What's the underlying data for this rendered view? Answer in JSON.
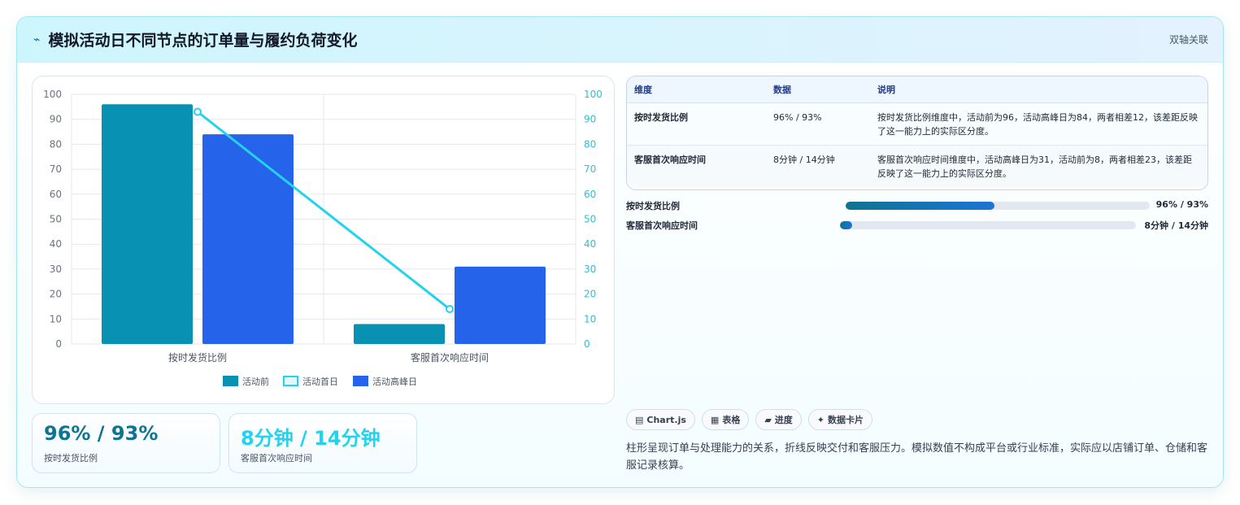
{
  "header": {
    "icon": "pulse-icon",
    "title": "模拟活动日不同节点的订单量与履约负荷变化",
    "tag": "双轴关联"
  },
  "chart_data": {
    "type": "bar",
    "categories": [
      "按时发货比例",
      "客服首次响应时间"
    ],
    "series": [
      {
        "name": "活动前",
        "type": "bar",
        "axis": "left",
        "color": "#0891b2",
        "values": [
          96,
          8
        ]
      },
      {
        "name": "活动首日",
        "type": "line",
        "axis": "right",
        "color": "#22d3ee",
        "values": [
          93,
          14
        ]
      },
      {
        "name": "活动高峰日",
        "type": "bar",
        "axis": "left",
        "color": "#2563eb",
        "values": [
          84,
          31
        ]
      }
    ],
    "ylim": [
      0,
      100
    ],
    "y2lim": [
      0,
      100
    ],
    "yticks": [
      0,
      10,
      20,
      30,
      40,
      50,
      60,
      70,
      80,
      90,
      100
    ],
    "grid": true,
    "legend": "bottom",
    "title": "",
    "xlabel": "",
    "ylabel": ""
  },
  "stats": [
    {
      "value": "96% / 93%",
      "label": "按时发货比例",
      "color": "#0e7490"
    },
    {
      "value": "8分钟 / 14分钟",
      "label": "客服首次响应时间",
      "color": "#22d3ee"
    }
  ],
  "table": {
    "headers": [
      "维度",
      "数据",
      "说明"
    ],
    "rows": [
      [
        "按时发货比例",
        "96% / 93%",
        "按时发货比例维度中，活动前为96，活动高峰日为84，两者相差12，该差距反映了这一能力上的实际区分度。"
      ],
      [
        "客服首次响应时间",
        "8分钟 / 14分钟",
        "客服首次响应时间维度中，活动高峰日为31，活动前为8，两者相差23，该差距反映了这一能力上的实际区分度。"
      ]
    ]
  },
  "progress": [
    {
      "label": "按时发货比例",
      "value": "96% / 93%",
      "fraction": 0.49
    },
    {
      "label": "客服首次响应时间",
      "value": "8分钟 / 14分钟",
      "fraction": 0.04
    }
  ],
  "chips": [
    {
      "icon": "chart-icon",
      "label": "Chart.js"
    },
    {
      "icon": "table-icon",
      "label": "表格"
    },
    {
      "icon": "progress-icon",
      "label": "进度"
    },
    {
      "icon": "card-icon",
      "label": "数据卡片"
    }
  ],
  "note": "柱形呈现订单与处理能力的关系，折线反映交付和客服压力。模拟数值不构成平台或行业标准，实际应以店铺订单、仓储和客服记录核算。"
}
